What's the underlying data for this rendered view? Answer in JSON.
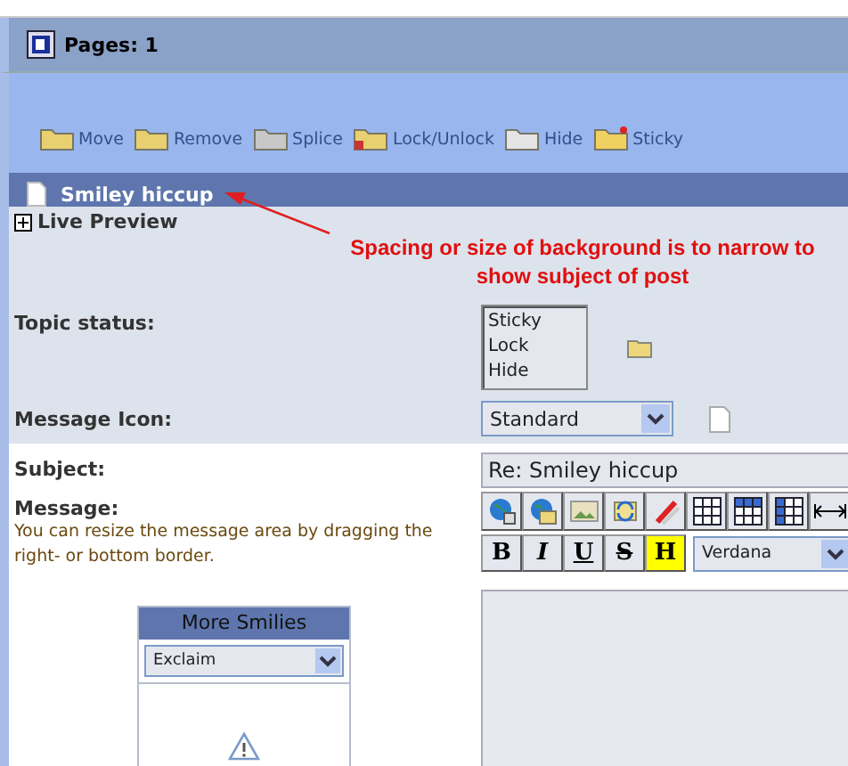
{
  "pages_bar": {
    "label": "Pages: 1"
  },
  "moderation_tools": [
    {
      "kind": "move",
      "label": "Move"
    },
    {
      "kind": "remove",
      "label": "Remove"
    },
    {
      "kind": "splice",
      "label": "Splice"
    },
    {
      "kind": "lock",
      "label": "Lock/Unlock"
    },
    {
      "kind": "hide",
      "label": "Hide"
    },
    {
      "kind": "sticky",
      "label": "Sticky"
    }
  ],
  "post_header": {
    "subject": "Smiley hiccup"
  },
  "live_preview": {
    "label": "Live Preview",
    "expanded": false
  },
  "annotation": {
    "text": "Spacing or size of background is to narrow to show subject of post"
  },
  "topic_status": {
    "label": "Topic status:",
    "options": [
      "Sticky",
      "Lock",
      "Hide"
    ]
  },
  "message_icon": {
    "label": "Message Icon:",
    "value": "Standard"
  },
  "subject": {
    "label": "Subject:",
    "value": "Re: Smiley hiccup"
  },
  "message": {
    "label": "Message:",
    "hint": "You can resize the message area by dragging the right- or bottom border."
  },
  "editor_icons": [
    {
      "kind": "globe-link"
    },
    {
      "kind": "globe-folder"
    },
    {
      "kind": "image"
    },
    {
      "kind": "refresh"
    },
    {
      "kind": "brush"
    },
    {
      "kind": "table"
    },
    {
      "kind": "table-header"
    },
    {
      "kind": "table-column"
    },
    {
      "kind": "width"
    }
  ],
  "format_buttons": [
    {
      "kind": "bold",
      "label": "B"
    },
    {
      "kind": "italic",
      "label": "I"
    },
    {
      "kind": "underline",
      "label": "U"
    },
    {
      "kind": "strike",
      "label": "S"
    },
    {
      "kind": "highlight",
      "label": "H"
    }
  ],
  "font_select": {
    "value": "Verdana"
  },
  "smilies": {
    "title": "More Smilies",
    "category": "Exclaim"
  }
}
